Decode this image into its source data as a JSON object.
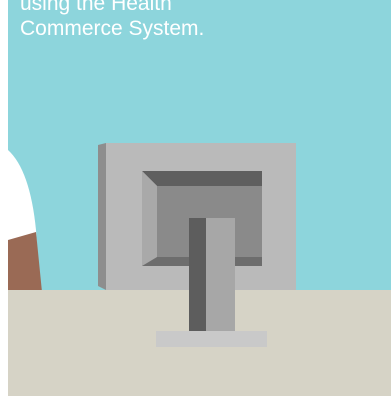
{
  "caption": {
    "line1": "using the Health",
    "line2": "Commerce System."
  },
  "colors": {
    "sky": "#8dd5dc",
    "desk": "#d6d3c6",
    "monitor_back": "#bababa",
    "monitor_panel": "#8a8a8a",
    "stand": "#a7a7a7",
    "stand_shadow": "#5d5d5d",
    "base": "#c9c9c9",
    "shirt": "#ffffff",
    "skin": "#9a6a55",
    "frame": "#ffffff"
  }
}
